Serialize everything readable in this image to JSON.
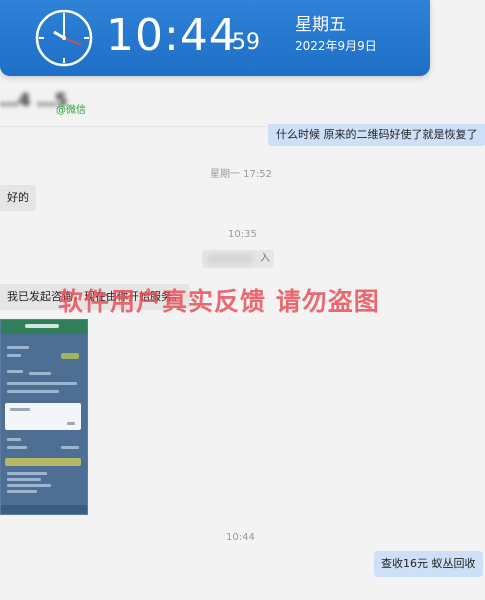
{
  "clock": {
    "time": "10:44",
    "seconds": "59",
    "weekday": "星期五",
    "date": "2022年9月9日"
  },
  "header": {
    "contact_name": "…4 …5",
    "source_label": "@微信"
  },
  "messages": {
    "out_1": "什么时候 原来的二维码好使了就是恢复了",
    "timestamp_1": "星期一 17:52",
    "in_1": "好的",
    "timestamp_2": "10:35",
    "system_notice": "入",
    "in_2": "我已发起咨询，现在由你开始服务。",
    "timestamp_3": "10:44",
    "out_2": "查收16元 蚁丛回收"
  },
  "watermark": "软件用户真实反馈  请勿盗图",
  "colors": {
    "clock_bg": "#2579d2",
    "outgoing_bubble": "#cde0f8",
    "incoming_bubble": "#e5e5e5",
    "watermark": "#e84a54",
    "source_green": "#27a336"
  }
}
